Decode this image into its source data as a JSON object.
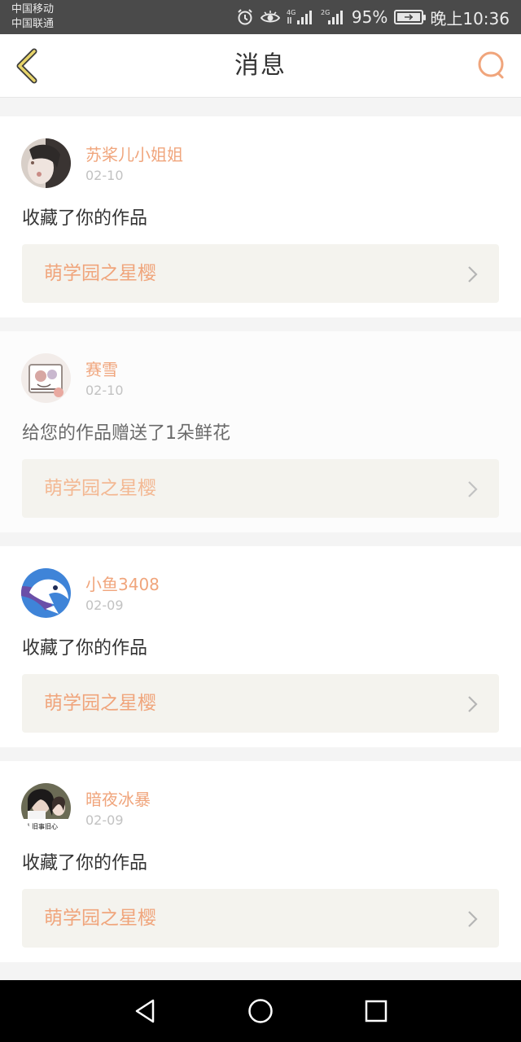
{
  "status_bar": {
    "carrier_1": "中国移动",
    "carrier_2": "中国联通",
    "net_1": "4G",
    "net_2": "2G",
    "battery_percent": "95%",
    "time": "晚上10:36"
  },
  "header": {
    "title": "消息",
    "back_icon": "chevron-left-icon",
    "search_icon": "search-icon"
  },
  "colors": {
    "accent": "#f0a57c",
    "status_bar_bg": "#4a4a4a",
    "page_bg": "#f4f4f4",
    "link_bg": "#f4f3ee"
  },
  "messages": [
    {
      "username": "苏桨儿小姐姐",
      "date": "02-10",
      "action": "收藏了你的作品",
      "work": "萌学园之星樱"
    },
    {
      "username": "赛雪",
      "date": "02-10",
      "action": "给您的作品赠送了1朵鲜花",
      "work": "萌学园之星樱"
    },
    {
      "username": "小鱼3408",
      "date": "02-09",
      "action": "收藏了你的作品",
      "work": "萌学园之星樱"
    },
    {
      "username": "暗夜冰暴",
      "date": "02-09",
      "action": "收藏了你的作品",
      "work": "萌学园之星樱",
      "avatar_caption": "人旧事旧心"
    }
  ],
  "system_nav": {
    "back_icon": "triangle-back-icon",
    "home_icon": "circle-home-icon",
    "recents_icon": "square-recents-icon"
  }
}
